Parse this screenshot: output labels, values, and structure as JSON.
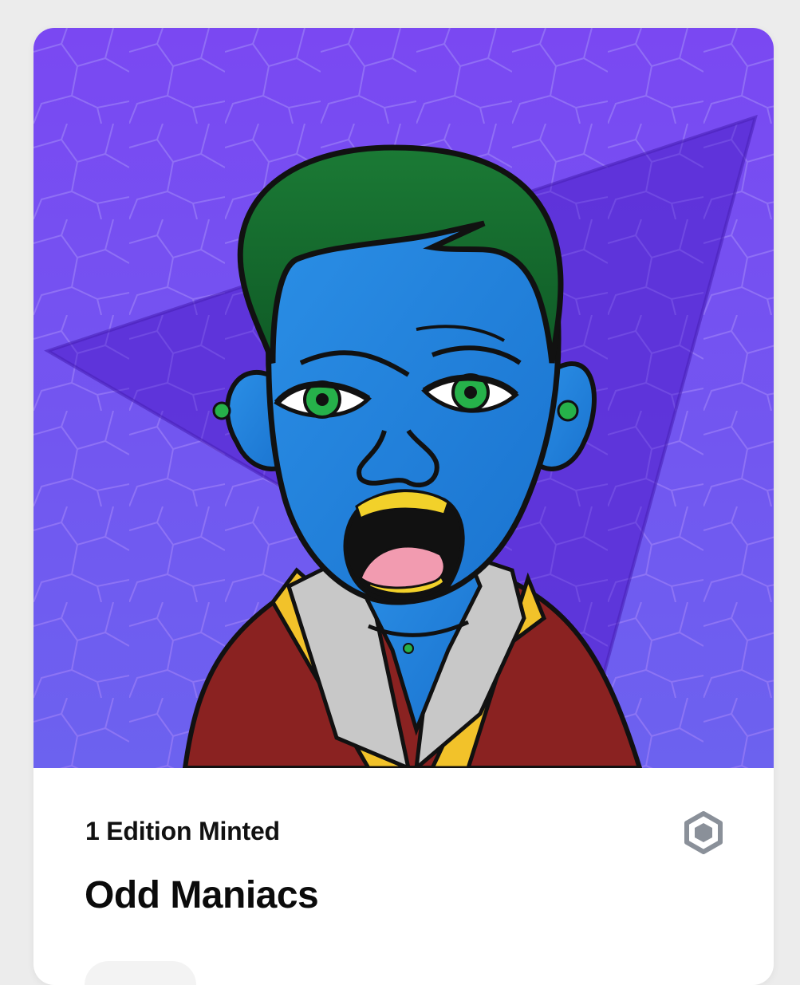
{
  "card": {
    "edition_text": "1 Edition Minted",
    "title": "Odd Maniacs",
    "chain_icon": "hexagon-chain-icon",
    "artwork_icon": "odd-maniac-character-image"
  },
  "colors": {
    "background_top": "#7b4cf0",
    "background_bottom": "#6f5cf0",
    "skin": "#1f87e3",
    "hair": "#1f8a3a",
    "eyes": "#26b14a",
    "jacket": "#8b2322",
    "collar_gold": "#f2c22a",
    "chain_icon": "#8a9099"
  }
}
